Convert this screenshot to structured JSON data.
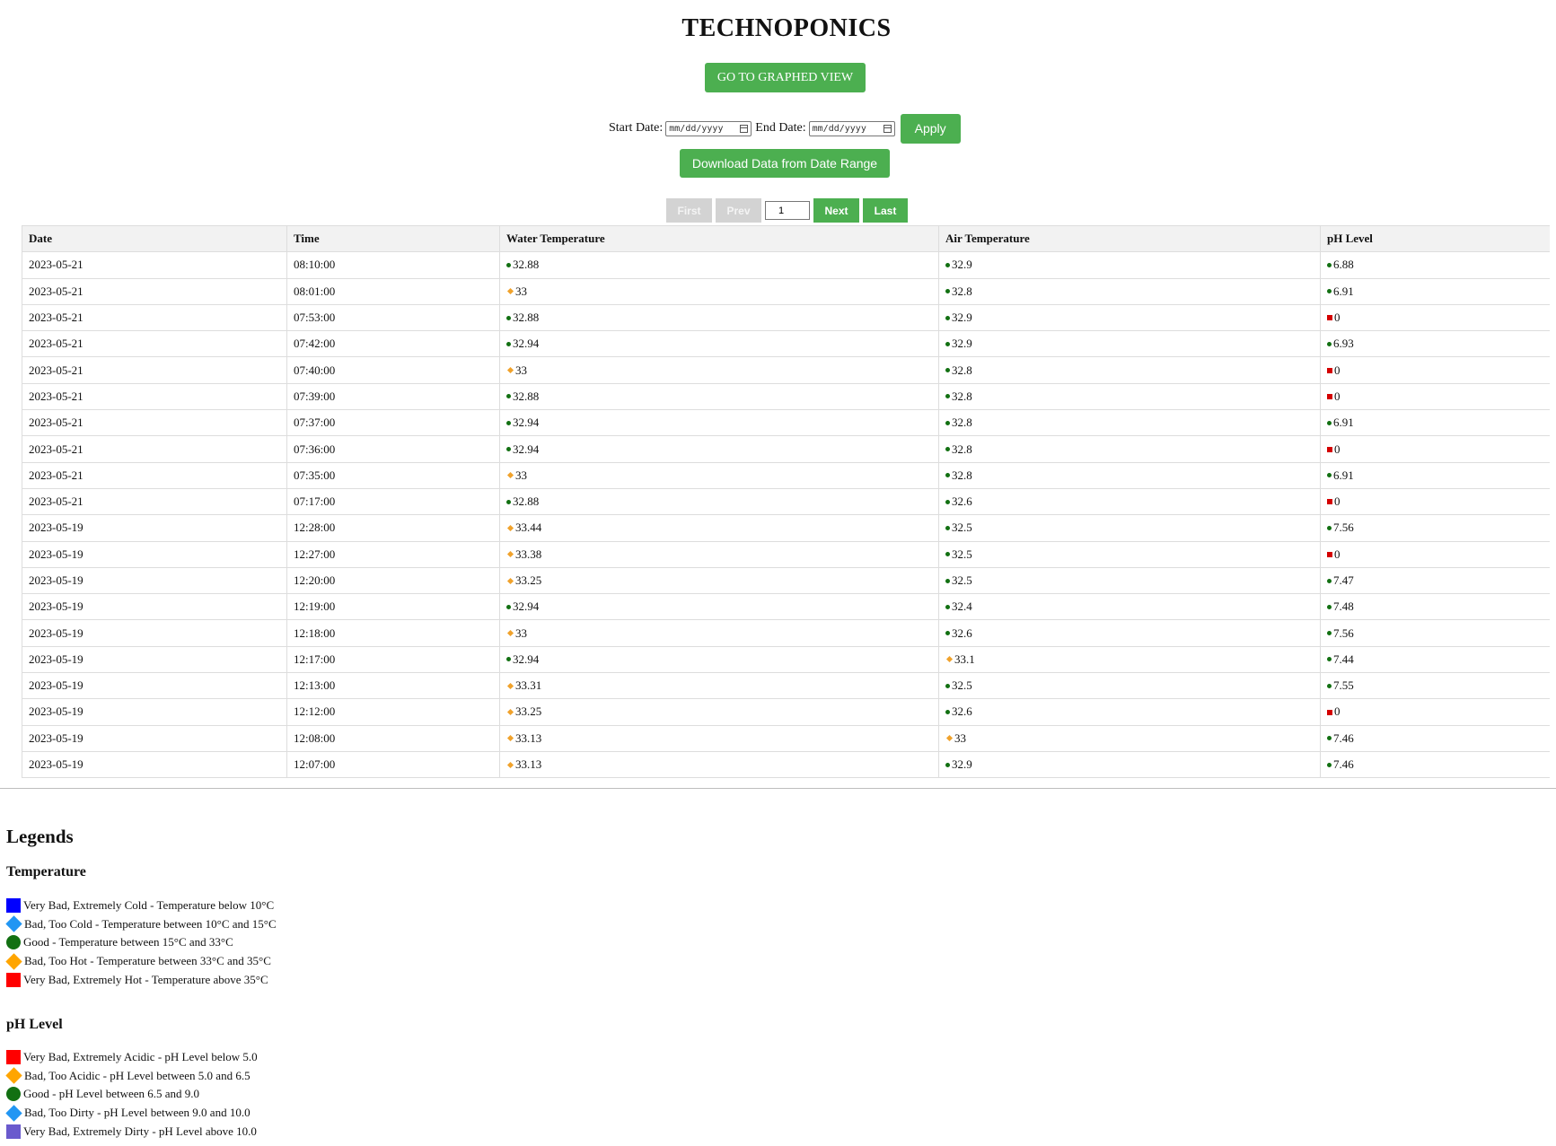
{
  "title": "TECHNOPONICS",
  "graph_button": "GO TO GRAPHED VIEW",
  "filters": {
    "start_label": "Start Date:",
    "end_label": "End Date:",
    "date_placeholder": "mm/dd/yyyy",
    "apply": "Apply",
    "download": "Download Data from Date Range"
  },
  "pagination": {
    "first": "First",
    "prev": "Prev",
    "page": "1",
    "next": "Next",
    "last": "Last"
  },
  "table": {
    "headers": [
      "Date",
      "Time",
      "Water Temperature",
      "Air Temperature",
      "pH Level"
    ],
    "rows": [
      [
        "2023-05-21",
        "08:10:00",
        [
          "good",
          "32.88"
        ],
        [
          "good",
          "32.9"
        ],
        [
          "good",
          "6.88"
        ]
      ],
      [
        "2023-05-21",
        "08:01:00",
        [
          "hot",
          "33"
        ],
        [
          "good",
          "32.8"
        ],
        [
          "good",
          "6.91"
        ]
      ],
      [
        "2023-05-21",
        "07:53:00",
        [
          "good",
          "32.88"
        ],
        [
          "good",
          "32.9"
        ],
        [
          "bad",
          "0"
        ]
      ],
      [
        "2023-05-21",
        "07:42:00",
        [
          "good",
          "32.94"
        ],
        [
          "good",
          "32.9"
        ],
        [
          "good",
          "6.93"
        ]
      ],
      [
        "2023-05-21",
        "07:40:00",
        [
          "hot",
          "33"
        ],
        [
          "good",
          "32.8"
        ],
        [
          "bad",
          "0"
        ]
      ],
      [
        "2023-05-21",
        "07:39:00",
        [
          "good",
          "32.88"
        ],
        [
          "good",
          "32.8"
        ],
        [
          "bad",
          "0"
        ]
      ],
      [
        "2023-05-21",
        "07:37:00",
        [
          "good",
          "32.94"
        ],
        [
          "good",
          "32.8"
        ],
        [
          "good",
          "6.91"
        ]
      ],
      [
        "2023-05-21",
        "07:36:00",
        [
          "good",
          "32.94"
        ],
        [
          "good",
          "32.8"
        ],
        [
          "bad",
          "0"
        ]
      ],
      [
        "2023-05-21",
        "07:35:00",
        [
          "hot",
          "33"
        ],
        [
          "good",
          "32.8"
        ],
        [
          "good",
          "6.91"
        ]
      ],
      [
        "2023-05-21",
        "07:17:00",
        [
          "good",
          "32.88"
        ],
        [
          "good",
          "32.6"
        ],
        [
          "bad",
          "0"
        ]
      ],
      [
        "2023-05-19",
        "12:28:00",
        [
          "hot",
          "33.44"
        ],
        [
          "good",
          "32.5"
        ],
        [
          "good",
          "7.56"
        ]
      ],
      [
        "2023-05-19",
        "12:27:00",
        [
          "hot",
          "33.38"
        ],
        [
          "good",
          "32.5"
        ],
        [
          "bad",
          "0"
        ]
      ],
      [
        "2023-05-19",
        "12:20:00",
        [
          "hot",
          "33.25"
        ],
        [
          "good",
          "32.5"
        ],
        [
          "good",
          "7.47"
        ]
      ],
      [
        "2023-05-19",
        "12:19:00",
        [
          "good",
          "32.94"
        ],
        [
          "good",
          "32.4"
        ],
        [
          "good",
          "7.48"
        ]
      ],
      [
        "2023-05-19",
        "12:18:00",
        [
          "hot",
          "33"
        ],
        [
          "good",
          "32.6"
        ],
        [
          "good",
          "7.56"
        ]
      ],
      [
        "2023-05-19",
        "12:17:00",
        [
          "good",
          "32.94"
        ],
        [
          "hot",
          "33.1"
        ],
        [
          "good",
          "7.44"
        ]
      ],
      [
        "2023-05-19",
        "12:13:00",
        [
          "hot",
          "33.31"
        ],
        [
          "good",
          "32.5"
        ],
        [
          "good",
          "7.55"
        ]
      ],
      [
        "2023-05-19",
        "12:12:00",
        [
          "hot",
          "33.25"
        ],
        [
          "good",
          "32.6"
        ],
        [
          "bad",
          "0"
        ]
      ],
      [
        "2023-05-19",
        "12:08:00",
        [
          "hot",
          "33.13"
        ],
        [
          "hot",
          "33"
        ],
        [
          "good",
          "7.46"
        ]
      ],
      [
        "2023-05-19",
        "12:07:00",
        [
          "hot",
          "33.13"
        ],
        [
          "good",
          "32.9"
        ],
        [
          "good",
          "7.46"
        ]
      ]
    ]
  },
  "legends": {
    "title": "Legends",
    "temperature": {
      "title": "Temperature",
      "items": [
        {
          "shape": "square",
          "color": "#0000ff",
          "label": "Very Bad, Extremely Cold - Temperature below 10°C"
        },
        {
          "shape": "diamond",
          "color": "#2196f3",
          "label": "Bad, Too Cold - Temperature between 10°C and 15°C"
        },
        {
          "shape": "circle",
          "color": "#127012",
          "label": "Good - Temperature between 15°C and 33°C"
        },
        {
          "shape": "diamond",
          "color": "#ffa500",
          "label": "Bad, Too Hot - Temperature between 33°C and 35°C"
        },
        {
          "shape": "square",
          "color": "#ff0000",
          "label": "Very Bad, Extremely Hot - Temperature above 35°C"
        }
      ]
    },
    "ph": {
      "title": "pH Level",
      "items": [
        {
          "shape": "square",
          "color": "#ff0000",
          "label": "Very Bad, Extremely Acidic - pH Level below 5.0"
        },
        {
          "shape": "diamond",
          "color": "#ffa500",
          "label": "Bad, Too Acidic - pH Level between 5.0 and 6.5"
        },
        {
          "shape": "circle",
          "color": "#127012",
          "label": "Good - pH Level between 6.5 and 9.0"
        },
        {
          "shape": "diamond",
          "color": "#2196f3",
          "label": "Bad, Too Dirty - pH Level between 9.0 and 10.0"
        },
        {
          "shape": "square",
          "color": "#6a5acd",
          "label": "Very Bad, Extremely Dirty - pH Level above 10.0"
        }
      ]
    }
  }
}
